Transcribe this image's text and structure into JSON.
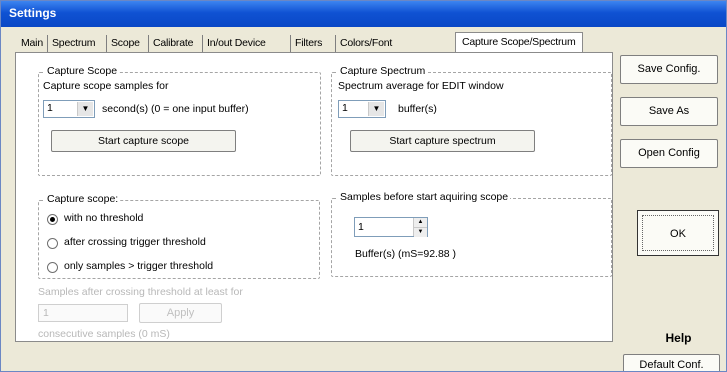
{
  "window": {
    "title": "Settings"
  },
  "tabs": [
    "Main",
    "Spectrum",
    "Scope",
    "Calibrate",
    "In/out Device",
    "Filters",
    "Colors/Font",
    "Capture Scope/Spectrum"
  ],
  "capture_scope": {
    "group_label": "Capture Scope",
    "description": "Capture scope samples for",
    "combo_value": "1",
    "unit_label": "second(s) (0 = one input buffer)",
    "button_label": "Start capture scope"
  },
  "capture_spectrum": {
    "group_label": "Capture Spectrum",
    "description": "Spectrum average for EDIT window",
    "combo_value": "1",
    "unit_label": "buffer(s)",
    "button_label": "Start capture spectrum"
  },
  "threshold": {
    "group_label": "Capture scope:",
    "options": [
      "with no threshold",
      "after crossing trigger threshold",
      "only samples > trigger threshold"
    ],
    "selected_index": 0
  },
  "samples_before": {
    "group_label": "Samples before start aquiring scope",
    "spin_value": "1",
    "buffer_info": "Buffer(s) (mS=92.88 )"
  },
  "disabled_area": {
    "label": "Samples after crossing threshold at least for",
    "input_value": "1",
    "apply_label": "Apply",
    "note": "consecutive samples (0 mS)"
  },
  "side_buttons": {
    "save_config": "Save Config.",
    "save_as": "Save As",
    "open_config": "Open Config",
    "ok": "OK",
    "help": "Help",
    "default_conf": "Default Conf."
  }
}
